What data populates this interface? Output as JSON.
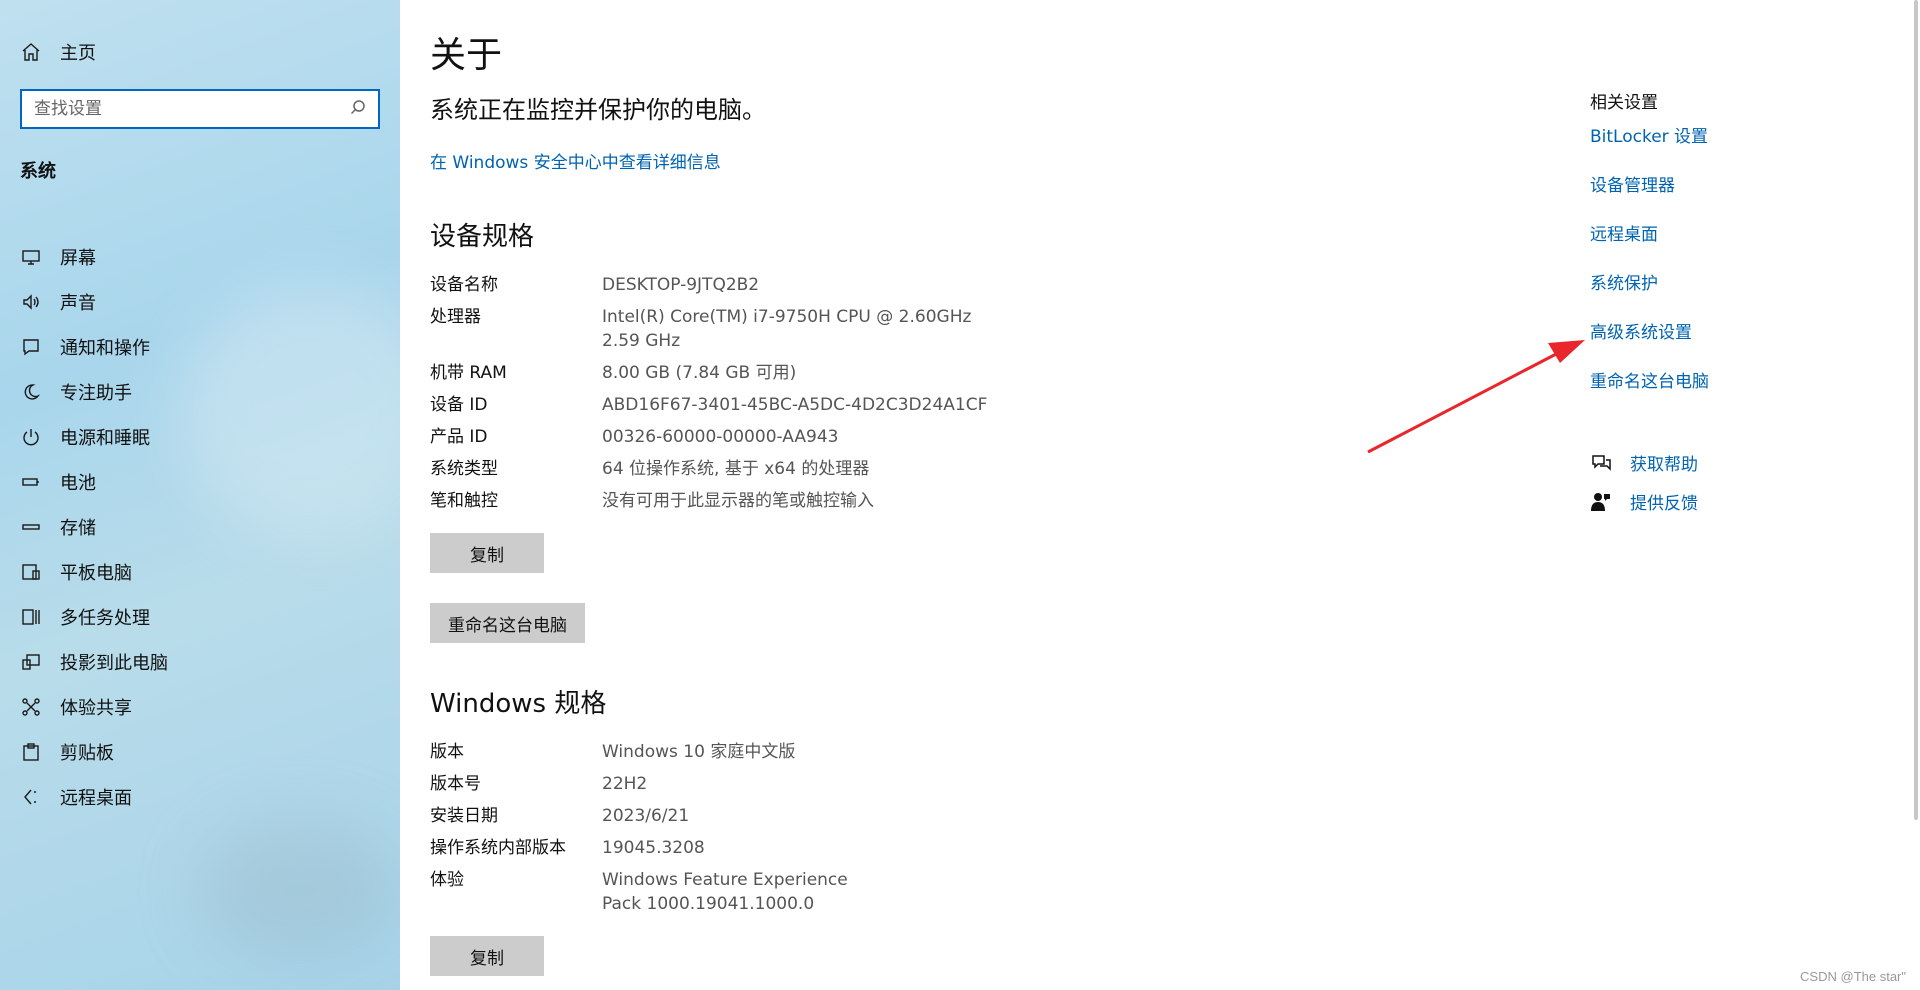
{
  "sidebar": {
    "home_label": "主页",
    "search_placeholder": "查找设置",
    "section_title": "系统",
    "items": [
      {
        "label": "屏幕",
        "icon": "monitor-icon"
      },
      {
        "label": "声音",
        "icon": "speaker-icon"
      },
      {
        "label": "通知和操作",
        "icon": "notification-icon"
      },
      {
        "label": "专注助手",
        "icon": "moon-icon"
      },
      {
        "label": "电源和睡眠",
        "icon": "power-icon"
      },
      {
        "label": "电池",
        "icon": "battery-icon"
      },
      {
        "label": "存储",
        "icon": "storage-icon"
      },
      {
        "label": "平板电脑",
        "icon": "tablet-icon"
      },
      {
        "label": "多任务处理",
        "icon": "multitask-icon"
      },
      {
        "label": "投影到此电脑",
        "icon": "project-icon"
      },
      {
        "label": "体验共享",
        "icon": "share-icon"
      },
      {
        "label": "剪贴板",
        "icon": "clipboard-icon"
      },
      {
        "label": "远程桌面",
        "icon": "remote-desktop-icon"
      }
    ]
  },
  "main": {
    "title": "关于",
    "status": "系统正在监控并保护你的电脑。",
    "security_link": "在 Windows 安全中心中查看详细信息",
    "device_specs": {
      "heading": "设备规格",
      "rows": [
        {
          "label": "设备名称",
          "value": "DESKTOP-9JTQ2B2"
        },
        {
          "label": "处理器",
          "value": "Intel(R) Core(TM) i7-9750H CPU @ 2.60GHz   2.59 GHz"
        },
        {
          "label": "机带 RAM",
          "value": "8.00 GB (7.84 GB 可用)"
        },
        {
          "label": "设备 ID",
          "value": "ABD16F67-3401-45BC-A5DC-4D2C3D24A1CF"
        },
        {
          "label": "产品 ID",
          "value": "00326-60000-00000-AA943"
        },
        {
          "label": "系统类型",
          "value": "64 位操作系统, 基于 x64 的处理器"
        },
        {
          "label": "笔和触控",
          "value": "没有可用于此显示器的笔或触控输入"
        }
      ],
      "copy_label": "复制",
      "rename_label": "重命名这台电脑"
    },
    "windows_specs": {
      "heading": "Windows 规格",
      "rows": [
        {
          "label": "版本",
          "value": "Windows 10 家庭中文版"
        },
        {
          "label": "版本号",
          "value": "22H2"
        },
        {
          "label": "安装日期",
          "value": "2023/6/21"
        },
        {
          "label": "操作系统内部版本",
          "value": "19045.3208"
        },
        {
          "label": "体验",
          "value": "Windows Feature Experience Pack 1000.19041.1000.0"
        }
      ],
      "copy_label": "复制"
    }
  },
  "related": {
    "title": "相关设置",
    "links": [
      "BitLocker 设置",
      "设备管理器",
      "远程桌面",
      "系统保护",
      "高级系统设置",
      "重命名这台电脑"
    ],
    "help_label": "获取帮助",
    "feedback_label": "提供反馈"
  },
  "watermark": "CSDN @The star\"",
  "colors": {
    "accent": "#0063b1",
    "arrow": "#e8262b",
    "button": "#cccccc"
  }
}
